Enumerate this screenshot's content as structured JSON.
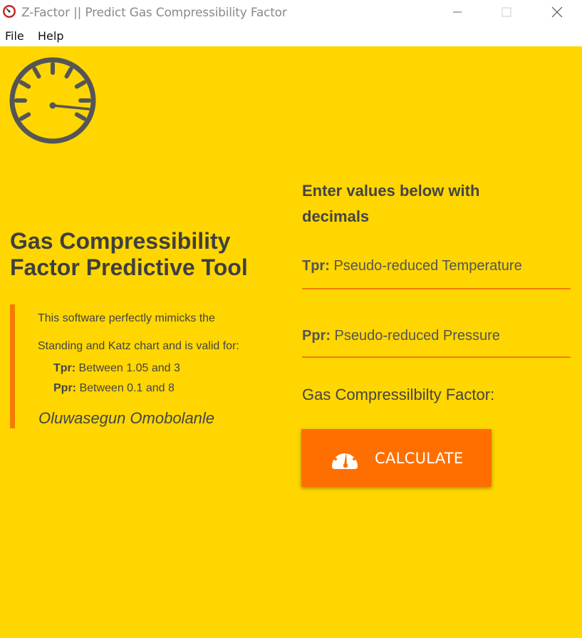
{
  "window": {
    "title": "Z-Factor || Predict Gas Compressibility Factor",
    "minimize_icon": "minimize-icon",
    "maximize_icon": "maximize-icon",
    "close_icon": "close-icon"
  },
  "menu": {
    "items": [
      "File",
      "Help"
    ]
  },
  "left": {
    "logo_icon": "speedometer-icon",
    "heading_line1": "Gas Compressibility",
    "heading_line2": "Factor Predictive Tool",
    "desc_line1": "This software perfectly mimicks the",
    "desc_line2": "Standing and Katz chart and is valid for:",
    "tpr_label": "Tpr:",
    "tpr_range": " Between 1.05 and 3",
    "ppr_label": "Ppr:",
    "ppr_range": " Between 0.1 and 8",
    "author": "Oluwasegun Omobolanle"
  },
  "right": {
    "instruction_line1": "Enter values below with",
    "instruction_line2": "decimals",
    "tpr_field": {
      "prefix": "Tpr:",
      "placeholder": " Pseudo-reduced Temperature",
      "value": ""
    },
    "ppr_field": {
      "prefix": "Ppr:",
      "placeholder": " Pseudo-reduced Pressure",
      "value": ""
    },
    "result_label": "Gas Compressilbilty Factor:",
    "calculate_button": {
      "label": "CALCULATE",
      "icon": "gauge-icon"
    }
  },
  "colors": {
    "background": "#FFD600",
    "accent": "#F57C00",
    "button": "#FF6F00",
    "text": "#444444"
  }
}
